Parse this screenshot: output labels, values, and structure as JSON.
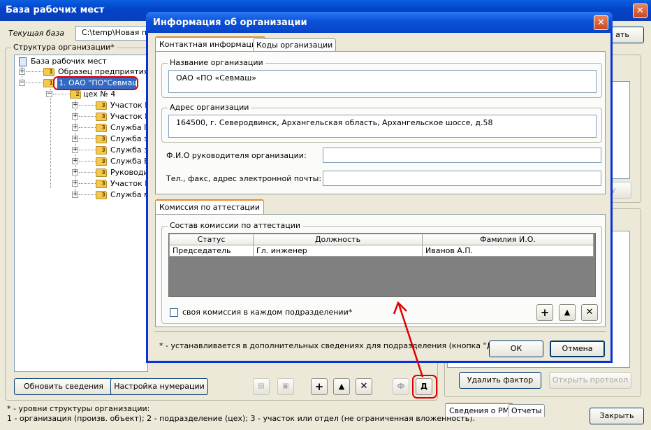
{
  "main": {
    "title": "База рабочих мест",
    "current_db_label": "Текущая база",
    "current_db_path": "C:\\temp\\Новая па",
    "top_right_button": "ать",
    "structure_group_label": "Структура организации*",
    "tree": {
      "root": "База рабочих мест",
      "items": [
        {
          "num": "1",
          "label": "Образец предприятия"
        },
        {
          "num": "1",
          "label": "1. ОАО \"ПО\"Севмаш\""
        },
        {
          "num": "2",
          "label": "цех № 4"
        },
        {
          "num": "3",
          "label": "Участок N"
        },
        {
          "num": "3",
          "label": "Участок N"
        },
        {
          "num": "3",
          "label": "Служба П."
        },
        {
          "num": "3",
          "label": "Служба эн"
        },
        {
          "num": "3",
          "label": "Служба за"
        },
        {
          "num": "3",
          "label": "Служба БИ"
        },
        {
          "num": "3",
          "label": "Руководит"
        },
        {
          "num": "3",
          "label": "Участок П"
        },
        {
          "num": "3",
          "label": "Служба ме"
        }
      ]
    },
    "update_button": "Обновить сведения",
    "numbering_button": "Настройка нумерации",
    "plus_btn": "+",
    "up_btn": "▲",
    "x_btn": "✕",
    "f_btn": "Ф",
    "d_btn": "Д",
    "footnote_1": "* - уровни структуры организации:",
    "footnote_2": "1 - организация (произв. объект); 2 - подразделение (цех); 3 - участок или отдел (не ограниченная вложенность).",
    "right": {
      "disabled_btn_top": "ту",
      "delete_factor": "Удалить фактор",
      "open_protocol": "Открыть протокол",
      "tab_rm": "Сведения о РМ",
      "tab_reports": "Отчеты",
      "close_button": "Закрыть"
    }
  },
  "dialog": {
    "title": "Информация об организации",
    "tabs": [
      "Контактная информация",
      "Коды организации"
    ],
    "org_name_label": "Название организации",
    "org_name_value": "ОАО «ПО «Севмаш»",
    "org_address_label": "Адрес организации",
    "org_address_value": "164500, г. Северодвинск, Архангельская область, Архангельское шоссе, д.58",
    "head_label": "Ф.И.О руководителя организации:",
    "head_value": "",
    "phone_label": "Тел., факс, адрес электронной почты:",
    "phone_value": "",
    "commission_tab": "Комиссия по аттестации",
    "commission_group": "Состав комиссии по аттестации",
    "columns": [
      "Статус",
      "Должность",
      "Фамилия И.О."
    ],
    "rows": [
      {
        "status": "Председатель",
        "position": "Гл. инженер",
        "name": "Иванов А.П."
      }
    ],
    "checkbox_label": "своя комиссия в каждом подразделении*",
    "footnote": "* - устанавливается в дополнительных сведениях для подразделения (кнопка \"Д\")",
    "ok": "ОК",
    "cancel": "Отмена",
    "plus_btn": "+",
    "up_btn": "▲",
    "x_btn": "✕"
  },
  "colors": {
    "highlight": "#e00000",
    "selection": "#316ac5",
    "grid_empty": "#808080"
  }
}
